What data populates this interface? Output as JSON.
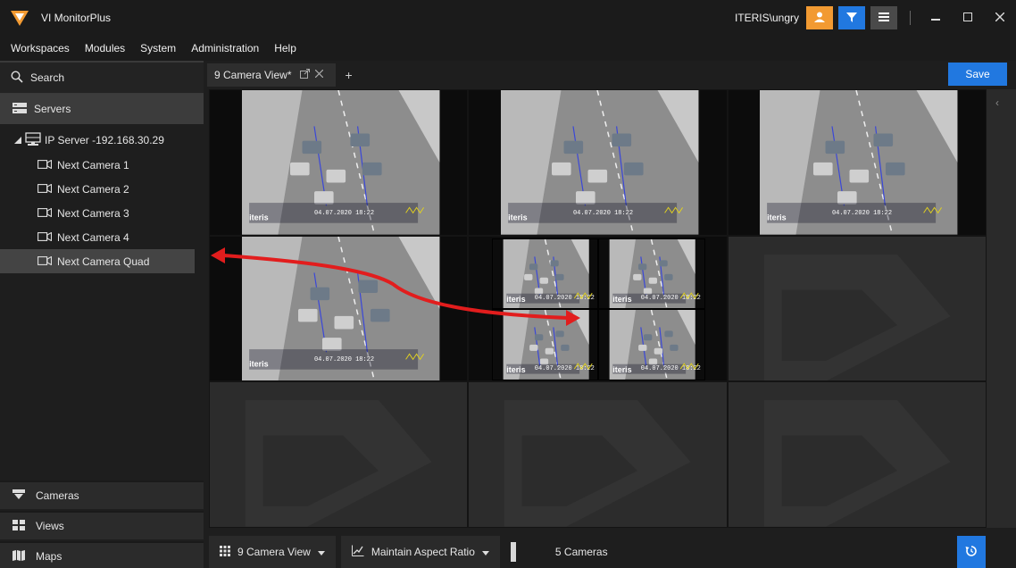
{
  "app": {
    "title": "VI MonitorPlus",
    "user": "ITERIS\\ungry"
  },
  "menu": [
    "Workspaces",
    "Modules",
    "System",
    "Administration",
    "Help"
  ],
  "sidebar": {
    "search_label": "Search",
    "servers_label": "Servers",
    "server": "IP Server -192.168.30.29",
    "cameras": [
      "Next Camera 1",
      "Next Camera 2",
      "Next Camera 3",
      "Next Camera 4",
      "Next Camera Quad"
    ],
    "selected_camera": "Next Camera Quad",
    "bottom": {
      "cameras": "Cameras",
      "views": "Views",
      "maps": "Maps"
    }
  },
  "tab": {
    "label": "9 Camera View*",
    "add": "+"
  },
  "toolbar": {
    "save_label": "Save"
  },
  "bottombar": {
    "layout": "9 Camera View",
    "aspect": "Maintain Aspect Ratio",
    "count": "5 Cameras"
  },
  "feed_overlay": {
    "brand": "iteris",
    "timestamp": "04.07.2020 18:22"
  },
  "colors": {
    "accent_blue": "#2178e0",
    "accent_orange": "#f29a32",
    "arrow": "#e21d1d",
    "selection": "#444444"
  },
  "icons": {
    "logo": "vi-logo-icon",
    "user": "user-icon",
    "filter": "filter-icon",
    "menu": "hamburger-icon",
    "search": "search-icon",
    "servers": "servers-icon",
    "server": "server-icon",
    "camera": "camera-icon",
    "views": "grid-icon",
    "maps": "map-icon",
    "refresh": "refresh-icon"
  }
}
